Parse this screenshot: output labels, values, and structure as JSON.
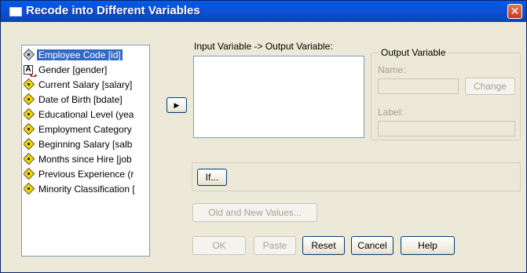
{
  "window": {
    "title": "Recode into Different Variables",
    "close_glyph": "✕"
  },
  "variables": [
    {
      "label": "Employee Code [id]",
      "icon": "scale-icon",
      "selected": true
    },
    {
      "label": "Gender [gender]",
      "icon": "nominal-icon",
      "selected": false
    },
    {
      "label": "Current Salary [salary]",
      "icon": "scale-icon",
      "selected": false
    },
    {
      "label": "Date of Birth [bdate]",
      "icon": "scale-icon",
      "selected": false
    },
    {
      "label": "Educational Level (yea",
      "icon": "scale-icon",
      "selected": false
    },
    {
      "label": "Employment Category",
      "icon": "scale-icon",
      "selected": false
    },
    {
      "label": "Beginning Salary [salb",
      "icon": "scale-icon",
      "selected": false
    },
    {
      "label": "Months since Hire [job",
      "icon": "scale-icon",
      "selected": false
    },
    {
      "label": "Previous Experience (r",
      "icon": "scale-icon",
      "selected": false
    },
    {
      "label": "Minority Classification [",
      "icon": "scale-icon",
      "selected": false
    }
  ],
  "transfer_button": {
    "glyph": "▶"
  },
  "io_section": {
    "label": "Input Variable -> Output Variable:"
  },
  "output_group": {
    "title": "Output Variable",
    "name_label": "Name:",
    "change_label": "Change",
    "label_label": "Label:"
  },
  "buttons": {
    "if_label": "If...",
    "old_new_label": "Old and New Values...",
    "ok_label": "OK",
    "paste_label": "Paste",
    "reset_label": "Reset",
    "cancel_label": "Cancel",
    "help_label": "Help"
  },
  "colors": {
    "title_bar": "#0a50d4",
    "selection": "#316ac5",
    "dialog_bg": "#ece9d8"
  }
}
